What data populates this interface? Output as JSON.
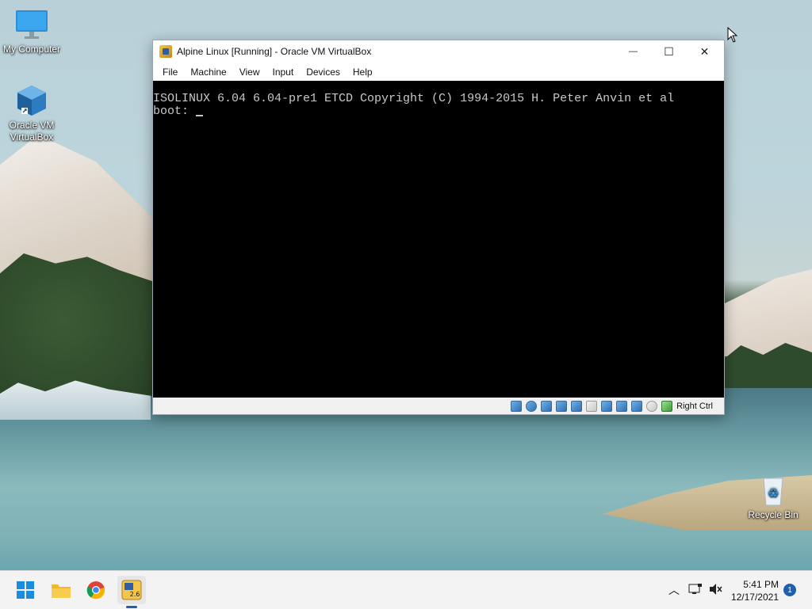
{
  "desktop": {
    "icons": [
      {
        "label": "My Computer",
        "icon": "monitor-icon"
      },
      {
        "label": "Oracle VM VirtualBox",
        "label_line1": "Oracle VM",
        "label_line2": "VirtualBox",
        "icon": "virtualbox-icon"
      },
      {
        "label": "Recycle Bin",
        "icon": "recycle-bin-icon"
      }
    ]
  },
  "window": {
    "title": "Alpine Linux [Running] - Oracle VM VirtualBox",
    "controls": {
      "minimize": "—",
      "maximize": "☐",
      "close": "✕"
    },
    "menu": [
      "File",
      "Machine",
      "View",
      "Input",
      "Devices",
      "Help"
    ],
    "terminal": {
      "lines": [
        "ISOLINUX 6.04 6.04-pre1 ETCD Copyright (C) 1994-2015 H. Peter Anvin et al",
        "boot: "
      ]
    },
    "statusbar": {
      "icons": [
        "hard-disk-icon",
        "optical-drive-icon",
        "audio-icon",
        "network-icon",
        "usb-icon",
        "shared-folders-icon",
        "display-icon",
        "video-capture-icon",
        "vt-x-icon",
        "mouse-integration-icon",
        "keyboard-capture-icon"
      ],
      "host_key": "Right Ctrl"
    }
  },
  "taskbar": {
    "apps": [
      "start-icon",
      "file-explorer-icon",
      "chrome-icon",
      "virtualbox-taskbar-icon"
    ],
    "clock_time": "5:41 PM",
    "clock_date": "12/17/2021",
    "notification_count": "1"
  },
  "colors": {
    "terminal_bg": "#000000",
    "terminal_fg": "#c8c8c8",
    "taskbar_bg": "#f3f3f3",
    "accent": "#1f5fae"
  }
}
